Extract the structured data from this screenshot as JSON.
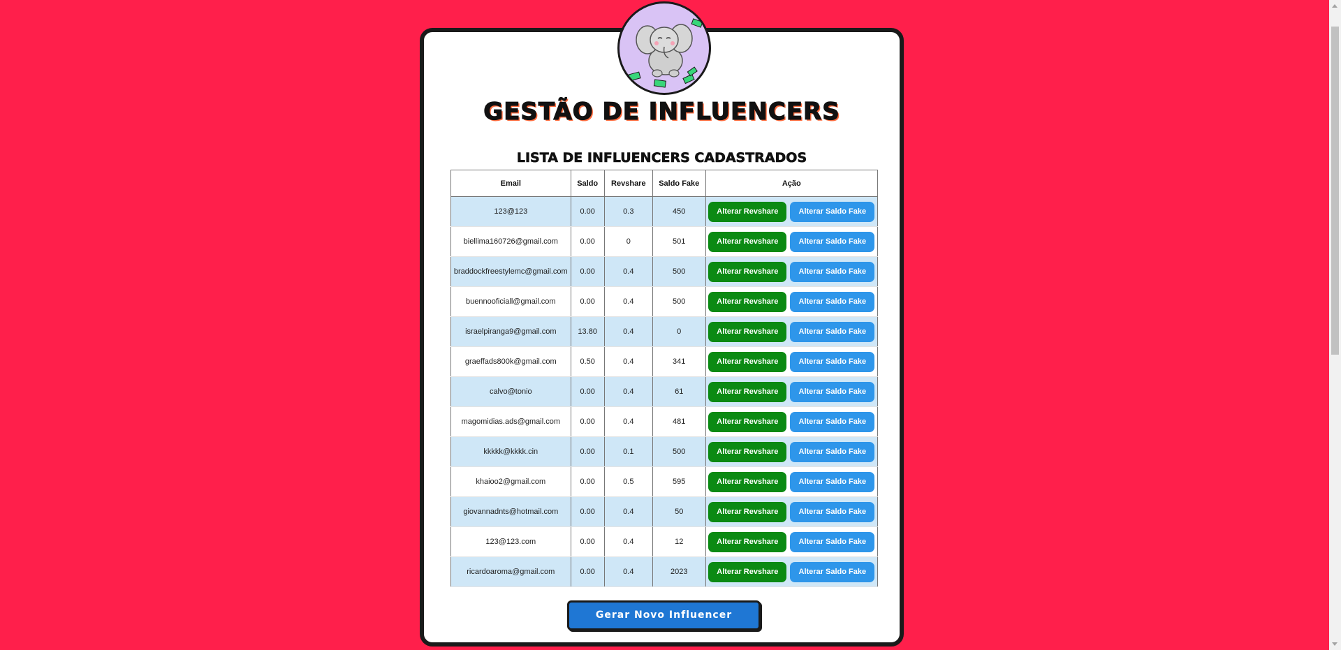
{
  "page": {
    "title": "GESTÃO DE INFLUENCERS",
    "subtitle": "LISTA DE INFLUENCERS CADASTRADOS",
    "generate_button": "Gerar Novo Influencer",
    "avatar_icon": "cartoon-elephant-money-icon"
  },
  "table": {
    "headers": {
      "email": "Email",
      "saldo": "Saldo",
      "revshare": "Revshare",
      "saldo_fake": "Saldo Fake",
      "acao": "Ação"
    },
    "rows": [
      {
        "email": "123@123",
        "saldo": "0.00",
        "revshare": "0.3",
        "saldo_fake": "450"
      },
      {
        "email": "biellima160726@gmail.com",
        "saldo": "0.00",
        "revshare": "0",
        "saldo_fake": "501"
      },
      {
        "email": "braddockfreestylemc@gmail.com",
        "saldo": "0.00",
        "revshare": "0.4",
        "saldo_fake": "500"
      },
      {
        "email": "buennooficiall@gmail.com",
        "saldo": "0.00",
        "revshare": "0.4",
        "saldo_fake": "500"
      },
      {
        "email": "israelpiranga9@gmail.com",
        "saldo": "13.80",
        "revshare": "0.4",
        "saldo_fake": "0"
      },
      {
        "email": "graeffads800k@gmail.com",
        "saldo": "0.50",
        "revshare": "0.4",
        "saldo_fake": "341"
      },
      {
        "email": "calvo@tonio",
        "saldo": "0.00",
        "revshare": "0.4",
        "saldo_fake": "61"
      },
      {
        "email": "magomidias.ads@gmail.com",
        "saldo": "0.00",
        "revshare": "0.4",
        "saldo_fake": "481"
      },
      {
        "email": "kkkkk@kkkk.cin",
        "saldo": "0.00",
        "revshare": "0.1",
        "saldo_fake": "500"
      },
      {
        "email": "khaioo2@gmail.com",
        "saldo": "0.00",
        "revshare": "0.5",
        "saldo_fake": "595"
      },
      {
        "email": "giovannadnts@hotmail.com",
        "saldo": "0.00",
        "revshare": "0.4",
        "saldo_fake": "50"
      },
      {
        "email": "123@123.com",
        "saldo": "0.00",
        "revshare": "0.4",
        "saldo_fake": "12"
      },
      {
        "email": "ricardoaroma@gmail.com",
        "saldo": "0.00",
        "revshare": "0.4",
        "saldo_fake": "2023"
      }
    ],
    "buttons": {
      "alterar_revshare": "Alterar Revshare",
      "alterar_saldo_fake": "Alterar Saldo Fake"
    }
  },
  "colors": {
    "background": "#ff1f4b",
    "row_highlight": "#cfe7f7",
    "revshare_button": "#0b8a13",
    "saldo_fake_button": "#2e96ea",
    "generate_button": "#1f77d4"
  }
}
